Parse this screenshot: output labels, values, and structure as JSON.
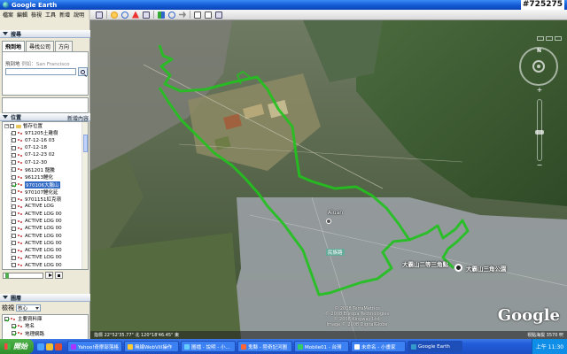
{
  "window": {
    "title": "Google Earth",
    "watermark": "#725275"
  },
  "menu": [
    "檔案",
    "編輯",
    "檢視",
    "工具",
    "新增",
    "說明"
  ],
  "search": {
    "header": "搜尋",
    "tabs": [
      "飛到地",
      "尋找公司",
      "方向"
    ],
    "fly_label": "飛到地",
    "fly_hint": "例如：San Francisco"
  },
  "places": {
    "header": "位置",
    "add_content": "新增內容",
    "items": [
      {
        "label": "暫存位置",
        "type": "folder",
        "checked": false,
        "indent": 0
      },
      {
        "label": "971205土雞樹",
        "type": "track",
        "checked": false,
        "indent": 1
      },
      {
        "label": "07-12-16 03",
        "type": "track",
        "checked": false,
        "indent": 1
      },
      {
        "label": "07-12-18",
        "type": "track",
        "checked": false,
        "indent": 1
      },
      {
        "label": "07-12-23 02",
        "type": "track",
        "checked": false,
        "indent": 1
      },
      {
        "label": "07-12-30",
        "type": "track",
        "checked": false,
        "indent": 1
      },
      {
        "label": "961201 龍騰",
        "type": "track",
        "checked": false,
        "indent": 1
      },
      {
        "label": "961213鯉化",
        "type": "track",
        "checked": false,
        "indent": 1
      },
      {
        "label": "970106大鵬山",
        "type": "track",
        "checked": true,
        "indent": 1,
        "selected": true
      },
      {
        "label": "970107鯉化延",
        "type": "track",
        "checked": false,
        "indent": 1
      },
      {
        "label": "9701151紅克嶺",
        "type": "track",
        "checked": false,
        "indent": 1
      },
      {
        "label": "ACTIVE LOG",
        "type": "track",
        "checked": false,
        "indent": 1
      },
      {
        "label": "ACTIVE LOG 00",
        "type": "track",
        "checked": false,
        "indent": 1
      },
      {
        "label": "ACTIVE LOG 00",
        "type": "track",
        "checked": false,
        "indent": 1
      },
      {
        "label": "ACTIVE LOG 00",
        "type": "track",
        "checked": false,
        "indent": 1
      },
      {
        "label": "ACTIVE LOG 00",
        "type": "track",
        "checked": false,
        "indent": 1
      },
      {
        "label": "ACTIVE LOG 00",
        "type": "track",
        "checked": false,
        "indent": 1
      },
      {
        "label": "ACTIVE LOG 00",
        "type": "track",
        "checked": false,
        "indent": 1
      },
      {
        "label": "ACTIVE LOG 00",
        "type": "track",
        "checked": false,
        "indent": 1
      },
      {
        "label": "ACTIVE LOG 00",
        "type": "track",
        "checked": false,
        "indent": 1
      }
    ]
  },
  "layers": {
    "header": "圖層",
    "view_label": "檢視",
    "view_select": "核心",
    "items": [
      {
        "label": "主要資料庫",
        "checked": true
      },
      {
        "label": "地名",
        "checked": true
      },
      {
        "label": "地理網路",
        "checked": true
      }
    ]
  },
  "map": {
    "labels": [
      {
        "text": "大霸山二等三角點",
        "kind": "poi"
      },
      {
        "text": "大霸山三角公園",
        "kind": "poi"
      },
      {
        "text": "Aiuan",
        "kind": "town"
      },
      {
        "text": "民族路",
        "kind": "road"
      }
    ],
    "copyright": [
      "© 2008 TerraMetrics",
      "© 2008 Europa Technologies",
      "© 2008 Kingway Ltd.",
      "Image © 2008 DigitalGlobe"
    ],
    "google_logo": "Google",
    "status_left": "指標 22°52'35.77\" 北 120°18'46.45\" 東",
    "status_right": "視點海拔 3570 呎",
    "compass_n": "N"
  },
  "taskbar": {
    "start_label": "開始",
    "tasks": [
      "Yahoo!奇摩部落格",
      "無線WebVill操作",
      "圖檔 - 說明 - 小...",
      "鬼縣 - 陸奇記河圖",
      "Mobile01 - 台灣",
      "未命名 - 小畫家",
      "Google Earth"
    ],
    "clock": "上午 11:30"
  }
}
